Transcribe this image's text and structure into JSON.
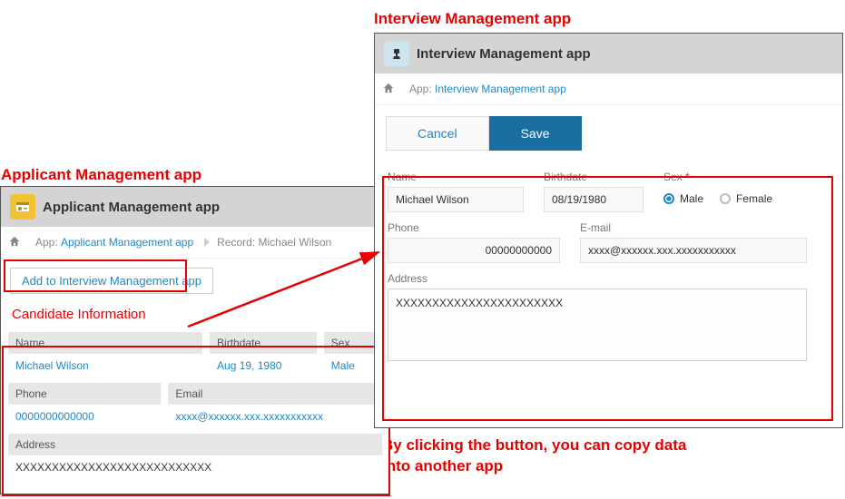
{
  "annotations": {
    "left_title": "Applicant Management app",
    "right_title": "Interview Management app",
    "caption_line1": "By clicking the button, you can copy data",
    "caption_line2": "into another app"
  },
  "left": {
    "title": "Applicant Management app",
    "breadcrumb_app_prefix": "App:",
    "breadcrumb_app_link": "Applicant Management app",
    "breadcrumb_record_prefix": "Record:",
    "breadcrumb_record": "Michael Wilson",
    "action_button": "Add to Interview Management app",
    "section_title": "Candidate Information",
    "labels": {
      "name": "Name",
      "birthdate": "Birthdate",
      "sex": "Sex",
      "phone": "Phone",
      "email": "Email",
      "address": "Address"
    },
    "values": {
      "name": "Michael Wilson",
      "birthdate": "Aug 19, 1980",
      "sex": "Male",
      "phone": "0000000000000",
      "email": "xxxx@xxxxxx.xxx.xxxxxxxxxxx",
      "address": "XXXXXXXXXXXXXXXXXXXXXXXXXXX"
    }
  },
  "right": {
    "title": "Interview Management app",
    "breadcrumb_app_prefix": "App:",
    "breadcrumb_app_link": "Interview Management app",
    "buttons": {
      "cancel": "Cancel",
      "save": "Save"
    },
    "labels": {
      "name": "Name",
      "birthdate": "Birthdate",
      "sex": "Sex",
      "phone": "Phone",
      "email": "E-mail",
      "address": "Address"
    },
    "values": {
      "name": "Michael Wilson",
      "birthdate": "08/19/1980",
      "sex_selected": "Male",
      "phone": "00000000000",
      "email": "xxxx@xxxxxx.xxx.xxxxxxxxxxx",
      "address": "XXXXXXXXXXXXXXXXXXXXXXX"
    },
    "sex_options": {
      "male": "Male",
      "female": "Female"
    },
    "required_mark": "*"
  }
}
